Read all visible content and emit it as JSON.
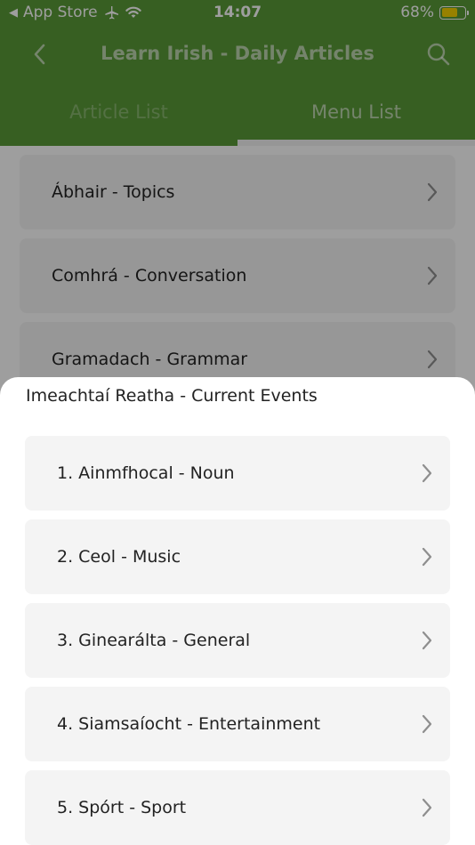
{
  "status_bar": {
    "back_app": "App Store",
    "time": "14:07",
    "battery": "68%",
    "battery_level": 0.68,
    "battery_color": "#f5d000"
  },
  "nav": {
    "title": "Learn Irish - Daily Articles",
    "back_icon": "chevron-left-icon",
    "search_icon": "search-icon"
  },
  "tabs": [
    {
      "label": "Article List",
      "active": false
    },
    {
      "label": "Menu List",
      "active": true
    }
  ],
  "menu_items": [
    {
      "label": "Ábhair - Topics"
    },
    {
      "label": "Comhrá - Conversation"
    },
    {
      "label": "Gramadach - Grammar"
    }
  ],
  "sheet": {
    "title": "Imeachtaí Reatha - Current Events",
    "items": [
      {
        "label": "1. Ainmfhocal - Noun"
      },
      {
        "label": "2. Ceol - Music"
      },
      {
        "label": "3. Ginearálta - General"
      },
      {
        "label": "4. Siamsaíocht - Entertainment"
      },
      {
        "label": "5. Spórt - Sport"
      }
    ]
  },
  "colors": {
    "header_green": "#5a9a38",
    "row_bg": "#f4f4f4",
    "chevron": "#8e8e8e"
  }
}
